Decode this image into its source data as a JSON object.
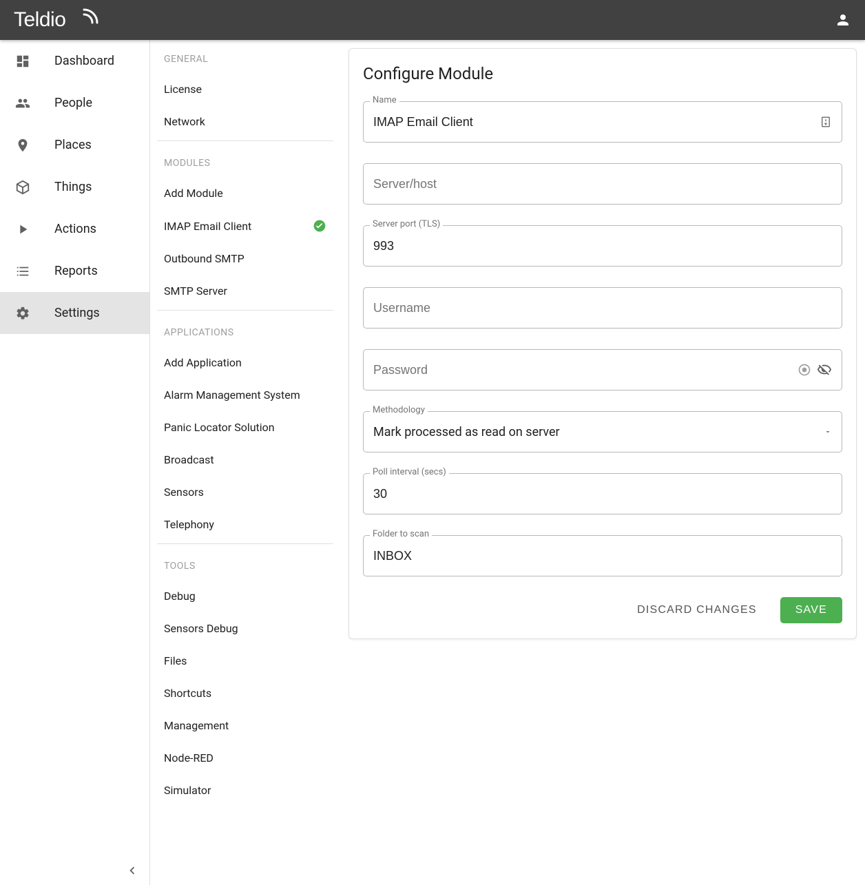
{
  "header": {
    "brand": "Teldio"
  },
  "sidebar": {
    "items": [
      {
        "label": "Dashboard",
        "icon": "dashboard"
      },
      {
        "label": "People",
        "icon": "people"
      },
      {
        "label": "Places",
        "icon": "place"
      },
      {
        "label": "Things",
        "icon": "cube"
      },
      {
        "label": "Actions",
        "icon": "play"
      },
      {
        "label": "Reports",
        "icon": "list"
      },
      {
        "label": "Settings",
        "icon": "gear",
        "active": true
      }
    ]
  },
  "subnav": {
    "groups": [
      {
        "header": "GENERAL",
        "items": [
          "License",
          "Network"
        ]
      },
      {
        "header": "MODULES",
        "items": [
          "Add Module",
          "IMAP Email Client",
          "Outbound SMTP",
          "SMTP Server"
        ],
        "check_index": 1
      },
      {
        "header": "APPLICATIONS",
        "items": [
          "Add Application",
          "Alarm Management System",
          "Panic Locator Solution",
          "Broadcast",
          "Sensors",
          "Telephony"
        ]
      },
      {
        "header": "TOOLS",
        "items": [
          "Debug",
          "Sensors Debug",
          "Files",
          "Shortcuts",
          "Management",
          "Node-RED",
          "Simulator"
        ]
      }
    ]
  },
  "form": {
    "title": "Configure Module",
    "fields": {
      "name": {
        "label": "Name",
        "value": "IMAP Email Client"
      },
      "server": {
        "placeholder": "Server/host",
        "value": ""
      },
      "port": {
        "label": "Server port (TLS)",
        "value": "993"
      },
      "username": {
        "placeholder": "Username",
        "value": ""
      },
      "password": {
        "placeholder": "Password",
        "value": ""
      },
      "methodology": {
        "label": "Methodology",
        "value": "Mark processed as read on server"
      },
      "poll": {
        "label": "Poll interval (secs)",
        "value": "30"
      },
      "folder": {
        "label": "Folder to scan",
        "value": "INBOX"
      }
    },
    "actions": {
      "discard": "DISCARD CHANGES",
      "save": "SAVE"
    }
  }
}
